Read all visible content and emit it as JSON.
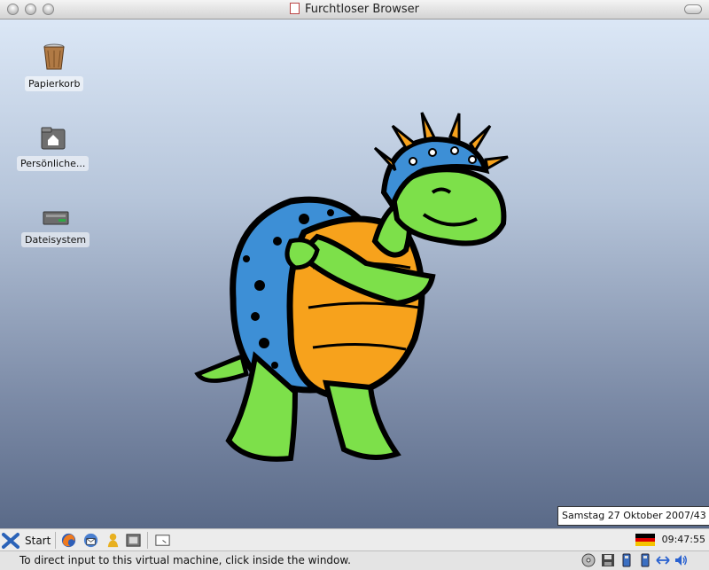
{
  "window": {
    "title": "Furchtloser Browser"
  },
  "desktop": {
    "icons": [
      {
        "label": "Papierkorb",
        "icon": "trash-icon"
      },
      {
        "label": "Persönliche...",
        "icon": "home-folder-icon"
      },
      {
        "label": "Dateisystem",
        "icon": "filesystem-icon"
      }
    ],
    "wallpaper": "turtle-mascot-illustration",
    "date_tooltip": "Samstag 27 Oktober 2007/43"
  },
  "taskbar": {
    "start_label": "Start",
    "quick_launch": [
      "firefox-icon",
      "thunderbird-icon",
      "contacts-icon",
      "film-icon",
      "desktop-icon"
    ],
    "flag": "german-flag-icon",
    "clock": "09:47:55"
  },
  "statusbar": {
    "text": "To direct input to this virtual machine, click inside the window.",
    "icons": [
      "cd-icon",
      "floppy-icon",
      "usb-icon",
      "usb-icon",
      "network-icon",
      "audio-icon"
    ]
  },
  "colors": {
    "accent": "#3b7bd8",
    "desktop_top": "#dbe7f6",
    "desktop_bottom": "#5a6a88"
  }
}
